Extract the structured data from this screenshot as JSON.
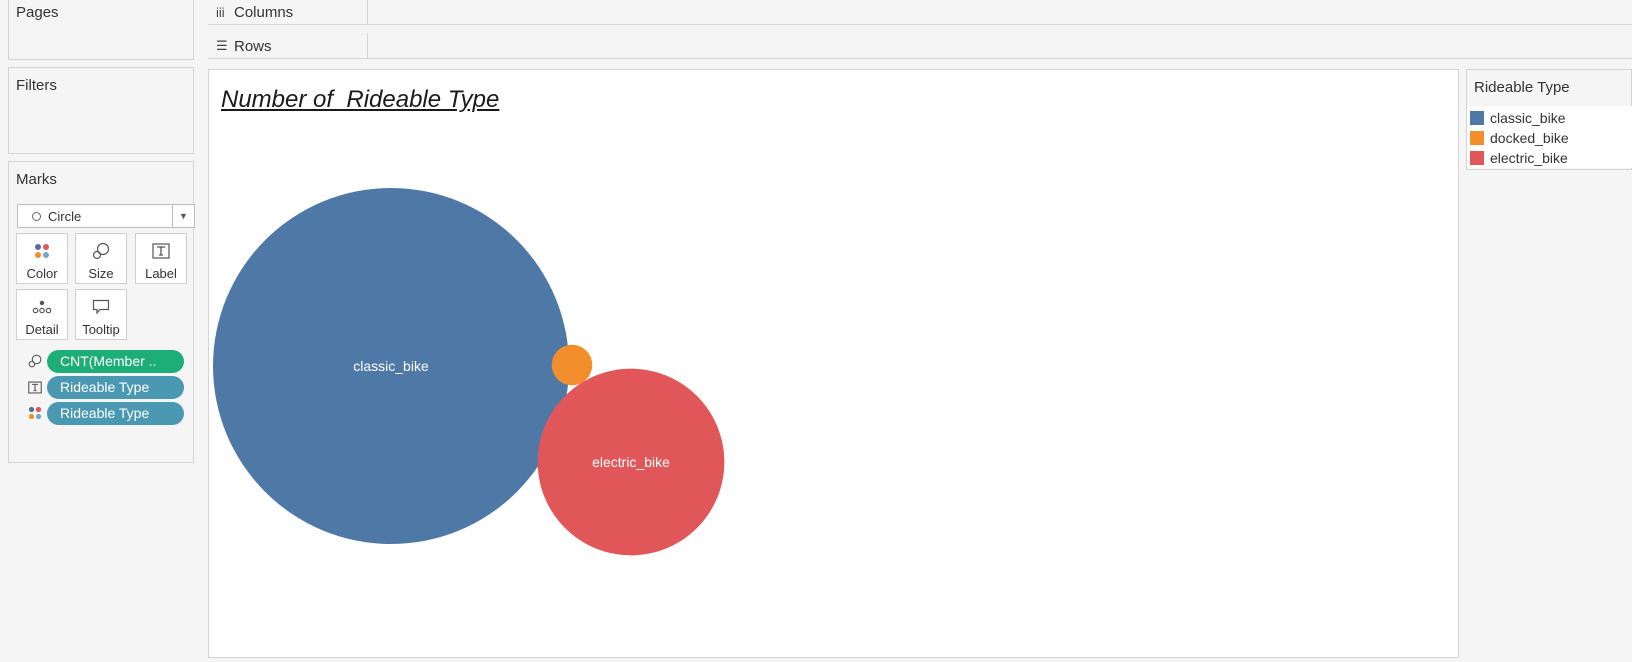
{
  "pages": {
    "title": "Pages"
  },
  "filters": {
    "title": "Filters"
  },
  "marks": {
    "title": "Marks",
    "mark_type": "Circle",
    "buttons": [
      {
        "label": "Color",
        "icon": "color-dots-icon"
      },
      {
        "label": "Size",
        "icon": "size-icon"
      },
      {
        "label": "Label",
        "icon": "label-t-icon"
      },
      {
        "label": "Detail",
        "icon": "detail-dots-icon"
      },
      {
        "label": "Tooltip",
        "icon": "tooltip-icon"
      }
    ],
    "pills": [
      {
        "label": "CNT(Member ..",
        "icon": "size-icon",
        "color": "#1dae78"
      },
      {
        "label": "Rideable Type",
        "icon": "label-t-icon",
        "color": "#4a98b1"
      },
      {
        "label": "Rideable Type",
        "icon": "color-dots-icon",
        "color": "#4a98b1"
      }
    ]
  },
  "shelves": {
    "columns": "Columns",
    "rows": "Rows"
  },
  "view": {
    "title": "Number of  Rideable Type"
  },
  "legend": {
    "title": "Rideable Type",
    "items": [
      {
        "label": "classic_bike",
        "color": "#4e79a7"
      },
      {
        "label": "docked_bike",
        "color": "#f28e2b"
      },
      {
        "label": "electric_bike",
        "color": "#e15759"
      }
    ]
  },
  "chart_data": {
    "type": "packed-bubble",
    "title": "Number of  Rideable Type",
    "categories": [
      "classic_bike",
      "docked_bike",
      "electric_bike"
    ],
    "relative_size": [
      1.0,
      0.013,
      0.275
    ],
    "labels_shown": [
      "classic_bike",
      "",
      "electric_bike"
    ],
    "colors": [
      "#4e79a7",
      "#f28e2b",
      "#e15759"
    ]
  }
}
